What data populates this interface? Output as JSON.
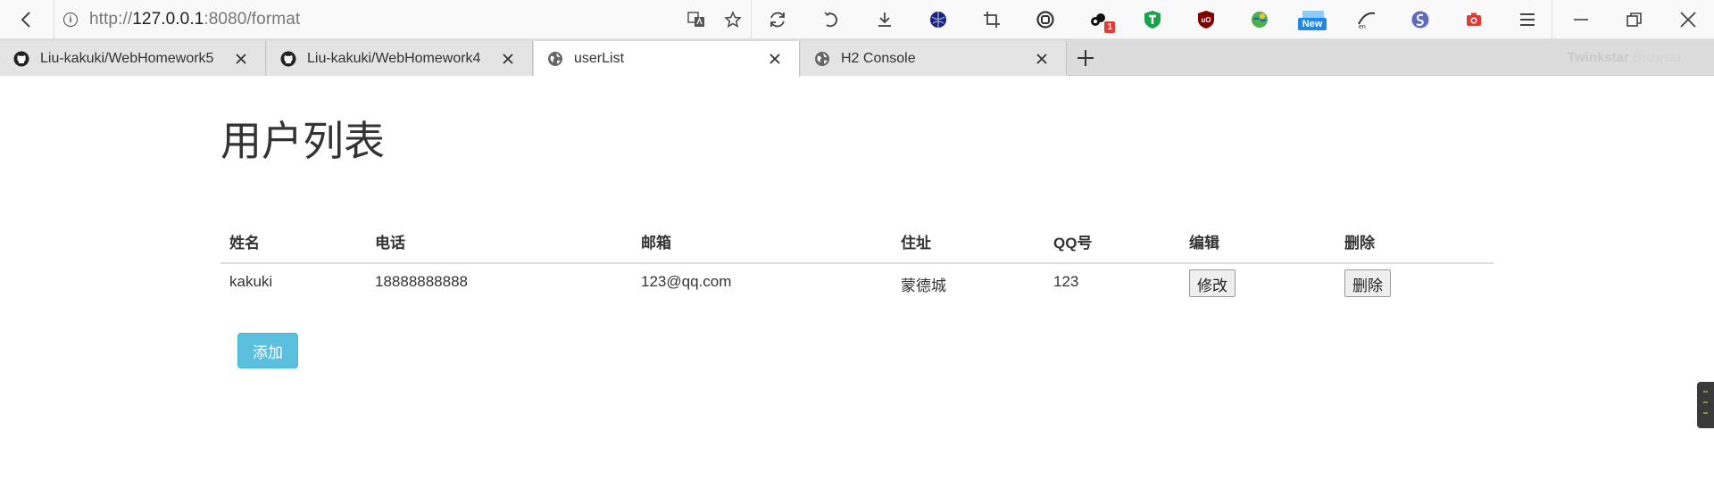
{
  "browser": {
    "url_prefix": "http://",
    "url_host": "127.0.0.1",
    "url_rest": ":8080/format",
    "brand_bold": "Twinkstar",
    "brand_light": " Browser",
    "extension_badge": "1",
    "extension_new_badge": "New",
    "tabs": [
      {
        "title": "Liu-kakuki/WebHomework5",
        "icon": "github-icon",
        "active": false
      },
      {
        "title": "Liu-kakuki/WebHomework4",
        "icon": "github-icon",
        "active": false
      },
      {
        "title": "userList",
        "icon": "globe-icon",
        "active": true
      },
      {
        "title": "H2 Console",
        "icon": "globe-icon",
        "active": false
      }
    ]
  },
  "page": {
    "title": "用户列表",
    "table": {
      "headers": [
        "姓名",
        "电话",
        "邮箱",
        "住址",
        "QQ号",
        "编辑",
        "删除"
      ],
      "rows": [
        {
          "name": "kakuki",
          "phone": "18888888888",
          "email": "123@qq.com",
          "address": "蒙德城",
          "qq": "123",
          "edit_label": "修改",
          "delete_label": "删除"
        }
      ]
    },
    "add_label": "添加"
  },
  "colors": {
    "add_button": "#5bc0de",
    "tab_strip": "#dcdcdc",
    "active_tab": "#ffffff"
  }
}
